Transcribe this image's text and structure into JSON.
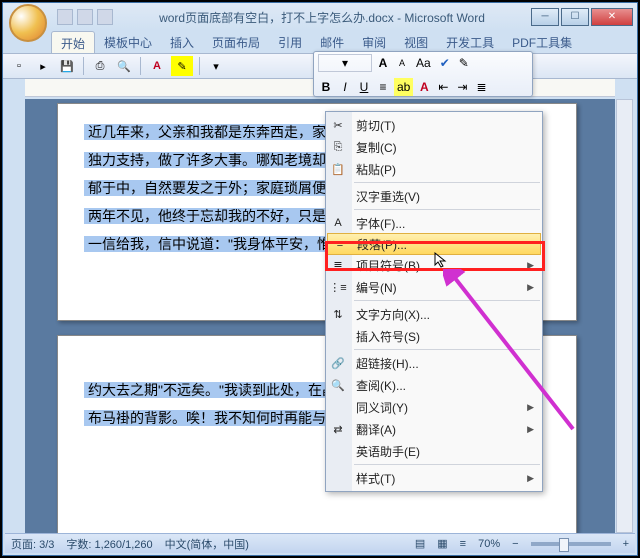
{
  "title": "word页面底部有空白，打不上字怎么办.docx - Microsoft Word",
  "tabs": [
    "开始",
    "模板中心",
    "插入",
    "页面布局",
    "引用",
    "邮件",
    "审阅",
    "视图",
    "开发工具",
    "PDF工具集"
  ],
  "active_tab": 0,
  "float_toolbar": {
    "bold": "B",
    "italic": "I",
    "underline": "U",
    "highlight": "ab",
    "font_inc": "A",
    "font_dec": "A",
    "change_case": "Aa"
  },
  "context_menu": [
    {
      "icon": "✂",
      "label": "剪切(T)",
      "sep": false,
      "sub": false
    },
    {
      "icon": "⎘",
      "label": "复制(C)",
      "sep": false,
      "sub": false
    },
    {
      "icon": "📋",
      "label": "粘贴(P)",
      "sep": false,
      "sub": false
    },
    {
      "sep": true
    },
    {
      "icon": "",
      "label": "汉字重选(V)",
      "sep": false,
      "sub": false
    },
    {
      "sep": true
    },
    {
      "icon": "A",
      "label": "字体(F)...",
      "sep": false,
      "sub": false
    },
    {
      "icon": "≡",
      "label": "段落(P)...",
      "sep": false,
      "sub": false,
      "hover": true
    },
    {
      "icon": "≣",
      "label": "项目符号(B)",
      "sep": false,
      "sub": true
    },
    {
      "icon": "⋮≡",
      "label": "编号(N)",
      "sep": false,
      "sub": true
    },
    {
      "sep": true
    },
    {
      "icon": "⇅",
      "label": "文字方向(X)...",
      "sep": false,
      "sub": false
    },
    {
      "icon": "",
      "label": "插入符号(S)",
      "sep": false,
      "sub": false
    },
    {
      "sep": true
    },
    {
      "icon": "🔗",
      "label": "超链接(H)...",
      "sep": false,
      "sub": false
    },
    {
      "icon": "🔍",
      "label": "查阅(K)...",
      "sep": false,
      "sub": false
    },
    {
      "icon": "",
      "label": "同义词(Y)",
      "sep": false,
      "sub": true
    },
    {
      "icon": "⇄",
      "label": "翻译(A)",
      "sep": false,
      "sub": true
    },
    {
      "icon": "",
      "label": "英语助手(E)",
      "sep": false,
      "sub": false
    },
    {
      "sep": true
    },
    {
      "icon": "",
      "label": "样式(T)",
      "sep": false,
      "sub": true
    }
  ],
  "doc_text": {
    "p1_l1": "近几年来，父亲和我都是东奔西走，家",
    "p1_l2": "独力支持，做了许多大事。哪知老境却如",
    "p1_l3": "郁于中，自然要发之于外；家庭琐屑便往",
    "p1_l4": "两年不见，他终于忘却我的不好，只是惦",
    "p1_l5": "一信给我，信中说道：\"我身体平安，惟",
    "p2_l1": "约大去之期\"不远矣。\"我读到此处，在晶",
    "p2_l2": "布马褂的背影。唉！我不知何时再能与他"
  },
  "status": {
    "page": "页面: 3/3",
    "words": "字数: 1,260/1,260",
    "lang": "中文(简体，中国)",
    "zoom": "70%"
  }
}
